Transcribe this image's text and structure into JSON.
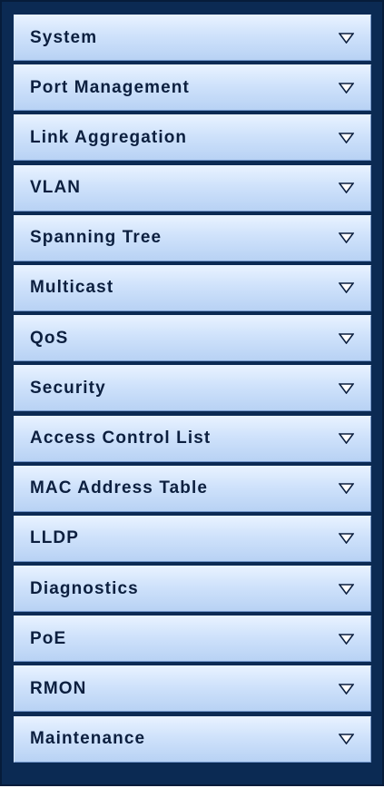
{
  "menu": {
    "items": [
      {
        "label": "System",
        "icon": "chevron-down-icon"
      },
      {
        "label": "Port Management",
        "icon": "chevron-down-icon"
      },
      {
        "label": "Link Aggregation",
        "icon": "chevron-down-icon"
      },
      {
        "label": "VLAN",
        "icon": "chevron-down-icon"
      },
      {
        "label": "Spanning Tree",
        "icon": "chevron-down-icon"
      },
      {
        "label": "Multicast",
        "icon": "chevron-down-icon"
      },
      {
        "label": "QoS",
        "icon": "chevron-down-icon"
      },
      {
        "label": "Security",
        "icon": "chevron-down-icon"
      },
      {
        "label": "Access Control List",
        "icon": "chevron-down-icon"
      },
      {
        "label": "MAC Address Table",
        "icon": "chevron-down-icon"
      },
      {
        "label": "LLDP",
        "icon": "chevron-down-icon"
      },
      {
        "label": "Diagnostics",
        "icon": "chevron-down-icon"
      },
      {
        "label": "PoE",
        "icon": "chevron-down-icon"
      },
      {
        "label": "RMON",
        "icon": "chevron-down-icon"
      },
      {
        "label": "Maintenance",
        "icon": "chevron-down-icon"
      }
    ]
  },
  "colors": {
    "frame_background": "#0b2a53",
    "item_gradient_top": "#e8f2ff",
    "item_gradient_bottom": "#b8d2f4",
    "label_text": "#0c1f3f"
  }
}
